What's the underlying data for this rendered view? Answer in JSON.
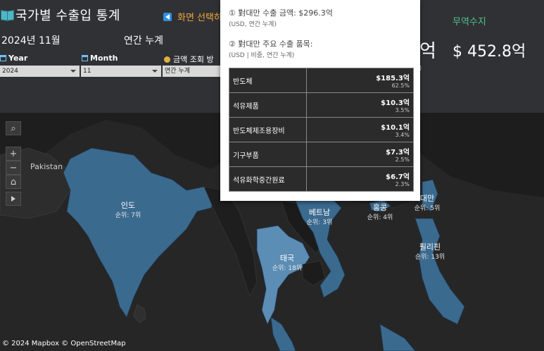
{
  "header": {
    "title": "국가별 수출입 통계",
    "screen_select": "화면 선택하",
    "period": "2024년 11월",
    "cumulative": "연간 누계"
  },
  "filters": {
    "year_label": "Year",
    "year_value": "2024",
    "month_label": "Month",
    "month_value": "11",
    "amount_label": "금액 조회 방",
    "amount_value": "연간 누계"
  },
  "kpi": {
    "partial_value": "억",
    "partial_small": ")",
    "trade_label": "무역수지",
    "trade_value": "$ 452.8억"
  },
  "tooltip": {
    "line1": "① 對대만 수출 금액: $296.3억",
    "line1_sub": "(USD,  연간 누계)",
    "line2": "② 對대만 주요 수출 품목:",
    "line2_sub": "(USD | 비중,  연간 누계)",
    "items": [
      {
        "name": "반도체",
        "amount": "$185.3억",
        "share": "62.5%"
      },
      {
        "name": "석유제품",
        "amount": "$10.3억",
        "share": "3.5%"
      },
      {
        "name": "반도체제조용장비",
        "amount": "$10.1억",
        "share": "3.4%"
      },
      {
        "name": "기구부품",
        "amount": "$7.3억",
        "share": "2.5%"
      },
      {
        "name": "석유화학중간원료",
        "amount": "$6.7억",
        "share": "2.3%"
      }
    ]
  },
  "map": {
    "pakistan": "Pakistan",
    "countries": [
      {
        "name": "인도",
        "rank": "순위: 7위"
      },
      {
        "name": "베트남",
        "rank": "순위: 3위"
      },
      {
        "name": "홍콩",
        "rank": "순위: 4위"
      },
      {
        "name": "대만",
        "rank": "순위: 5위"
      },
      {
        "name": "태국",
        "rank": "순위: 18위"
      },
      {
        "name": "필리핀",
        "rank": "순위: 13위"
      }
    ],
    "attribution": "© 2024 Mapbox  © OpenStreetMap"
  },
  "colors": {
    "header_bg": "#303134",
    "map_dark": "#262626",
    "region_blue": "#3b6a8f",
    "region_light": "#5b8db5",
    "trade_green": "#4fc38a",
    "accent_orange": "#f0a73a"
  }
}
